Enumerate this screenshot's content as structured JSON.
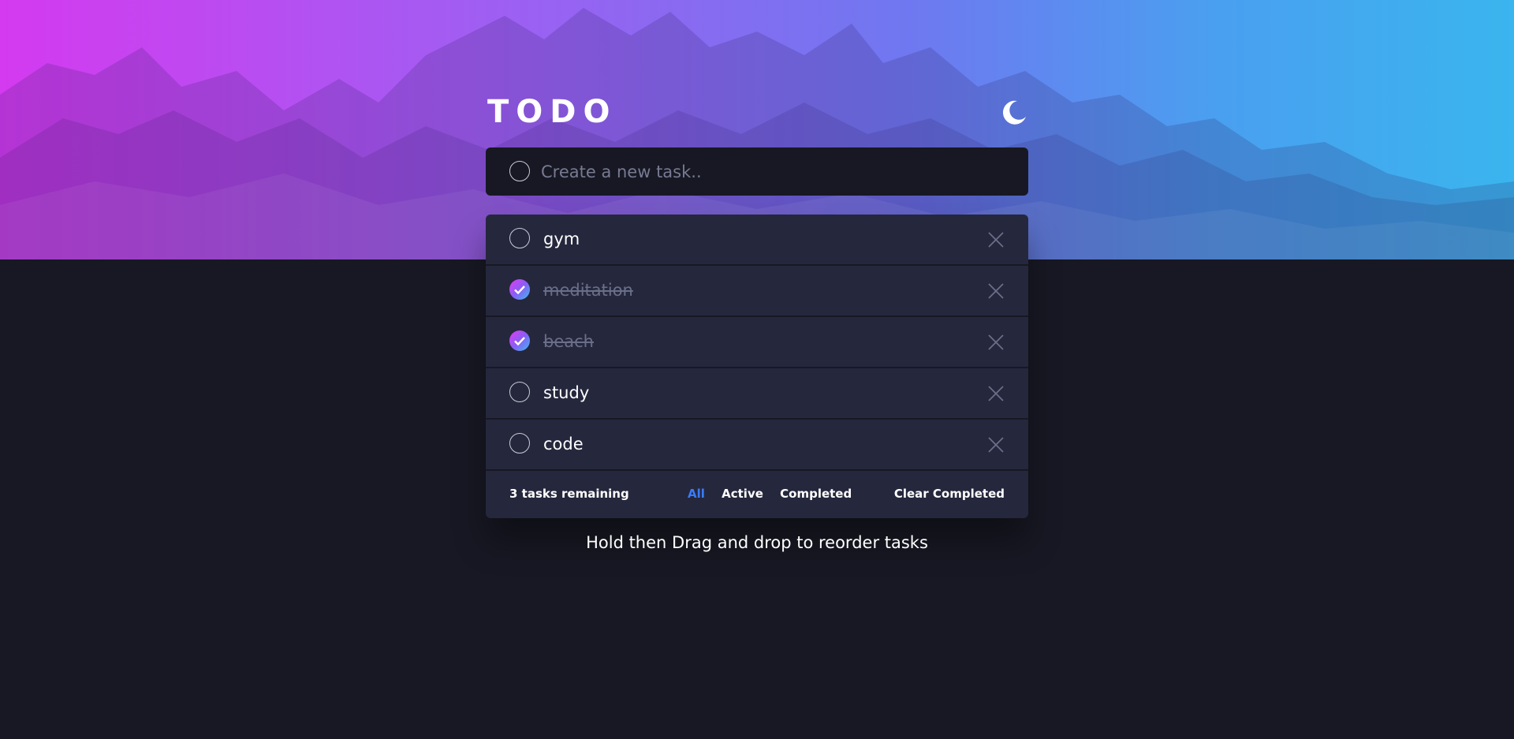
{
  "app": {
    "title": "TODO"
  },
  "theme": {
    "toggle_icon": "moon-icon"
  },
  "new_task": {
    "placeholder": "Create a new task.."
  },
  "tasks": [
    {
      "label": "gym",
      "completed": false
    },
    {
      "label": "meditation",
      "completed": true
    },
    {
      "label": "beach",
      "completed": true
    },
    {
      "label": "study",
      "completed": false
    },
    {
      "label": "code",
      "completed": false
    }
  ],
  "footer": {
    "remaining": "3 tasks remaining",
    "filters": {
      "all": "All",
      "active": "Active",
      "completed": "Completed"
    },
    "selected_filter": "All",
    "clear": "Clear Completed"
  },
  "hint": "Hold then Drag and drop to reorder tasks",
  "colors": {
    "background": "#171823",
    "card": "#25273d",
    "accent": "#3a7bfd",
    "gradient_start": "#d43af0",
    "gradient_end": "#3ab5ee"
  }
}
